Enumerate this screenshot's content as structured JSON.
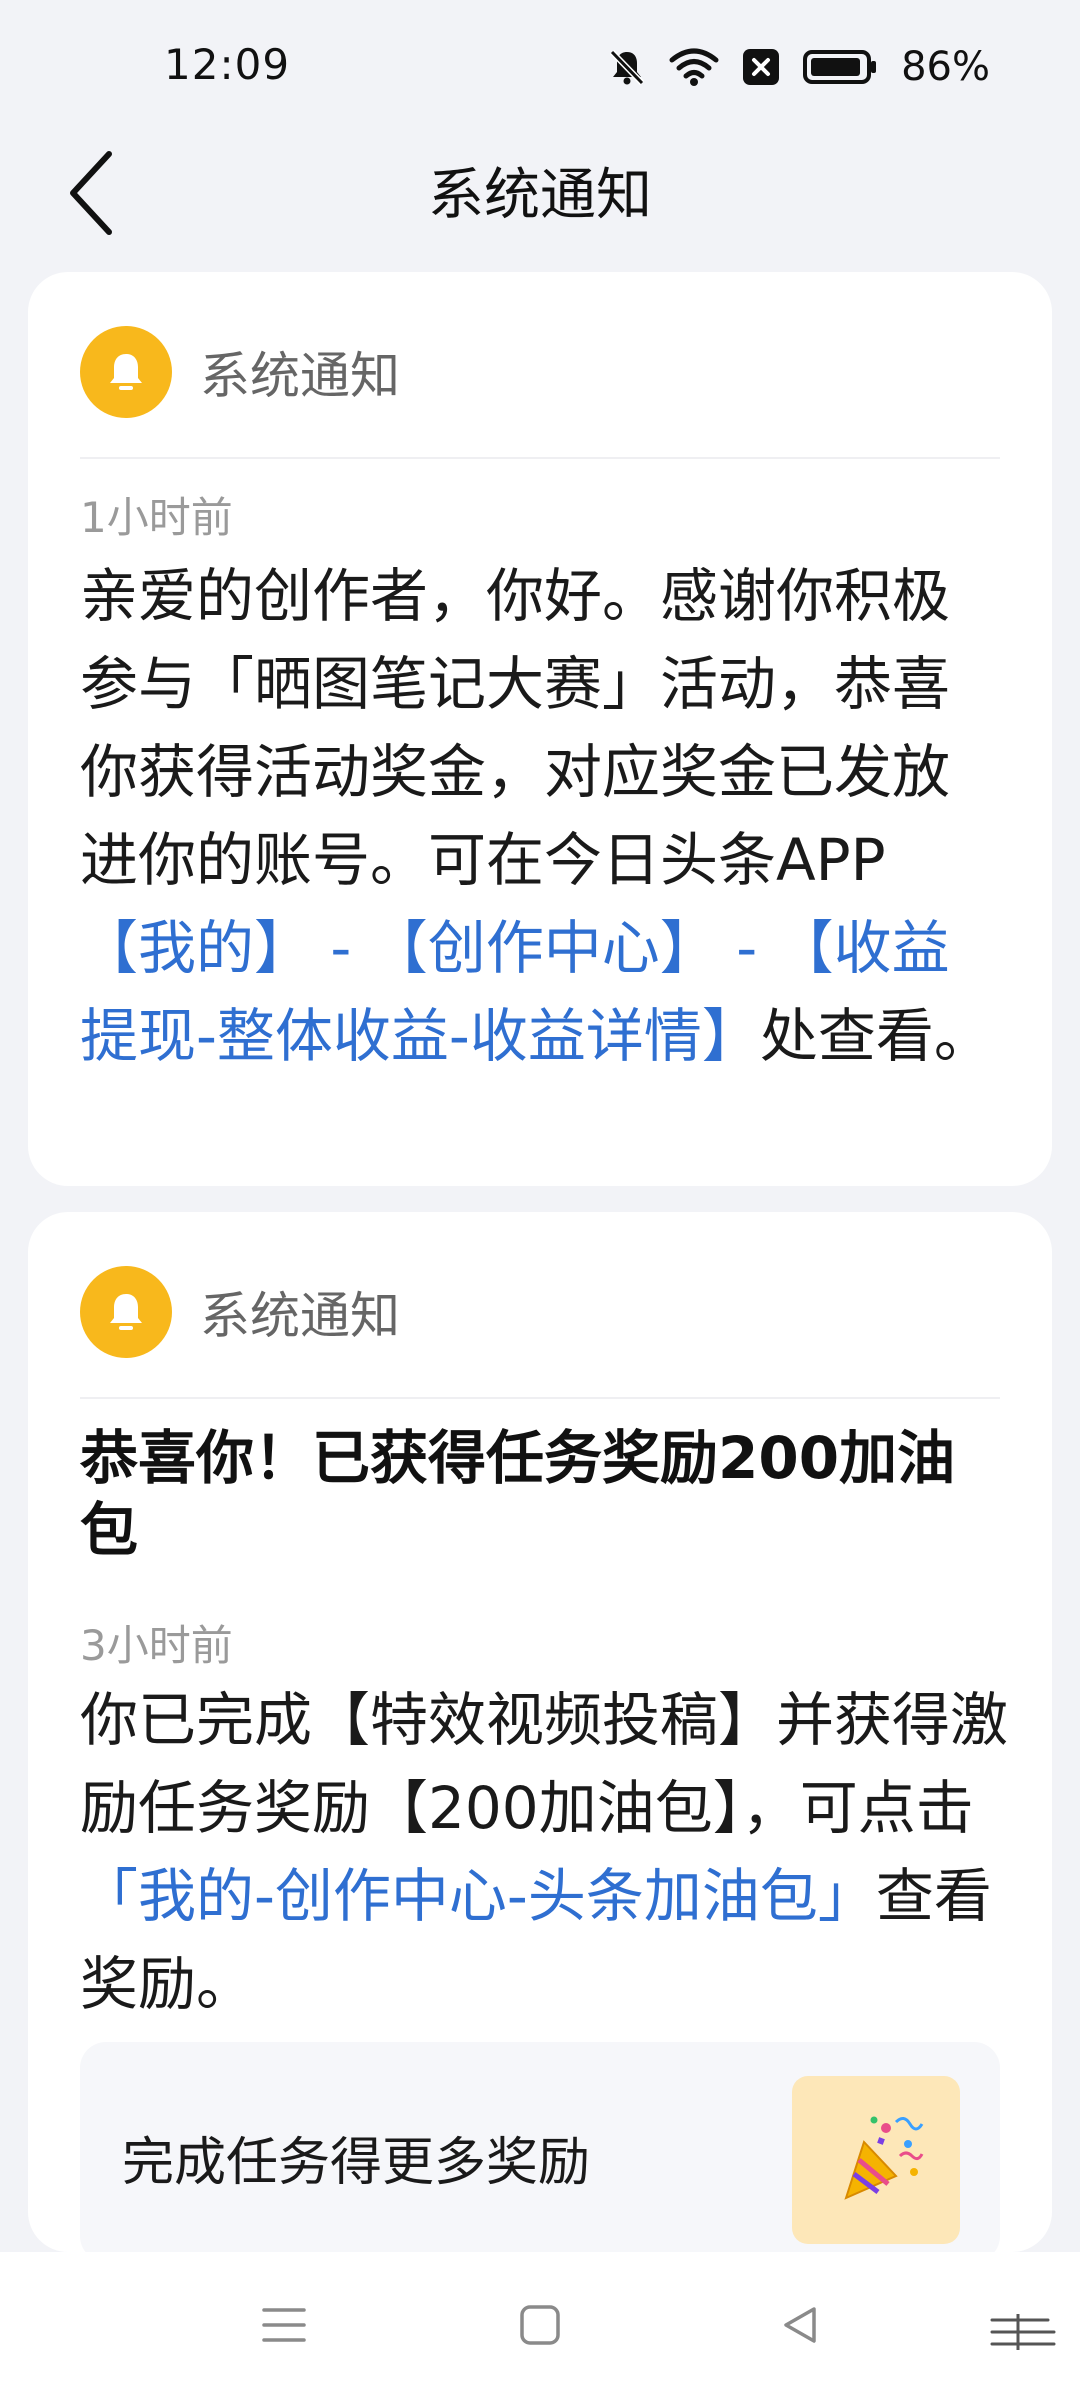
{
  "status_bar": {
    "time": "12:09",
    "battery_pct": "86%",
    "icons": [
      "bell-muted-icon",
      "wifi-icon",
      "close-box-icon",
      "battery-icon"
    ]
  },
  "header": {
    "back_icon": "chevron-left-icon",
    "title": "系统通知"
  },
  "notifications": [
    {
      "source": "系统通知",
      "icon": "bell-icon",
      "time": "1小时前",
      "body_plain_1": "亲爱的创作者，你好。感谢你积极参与「晒图笔记大赛」活动，恭喜你获得活动奖金，对应奖金已发放进你的账号。可在今日头条APP",
      "link_1": "【我的】 - 【创作中心】 - 【收益提现-整体收益-收益详情】",
      "body_plain_2": "处查看。"
    },
    {
      "source": "系统通知",
      "icon": "bell-icon",
      "title": "恭喜你！已获得任务奖励200加油包",
      "time": "3小时前",
      "body_plain_1": "你已完成【特效视频投稿】并获得激励任务奖励【200加油包】，可点击",
      "link_1": "「我的-创作中心-头条加油包」",
      "body_plain_2": "查看奖励。",
      "task_label": "完成任务得更多奖励",
      "task_icon": "party-popper-icon"
    }
  ],
  "nav_bar": {
    "items": [
      "menu-icon",
      "home-square-icon",
      "back-triangle-icon"
    ]
  },
  "colors": {
    "accent_link": "#2f6fd1",
    "bell_bg": "#f8b81c",
    "page_bg": "#f2f3f7"
  }
}
